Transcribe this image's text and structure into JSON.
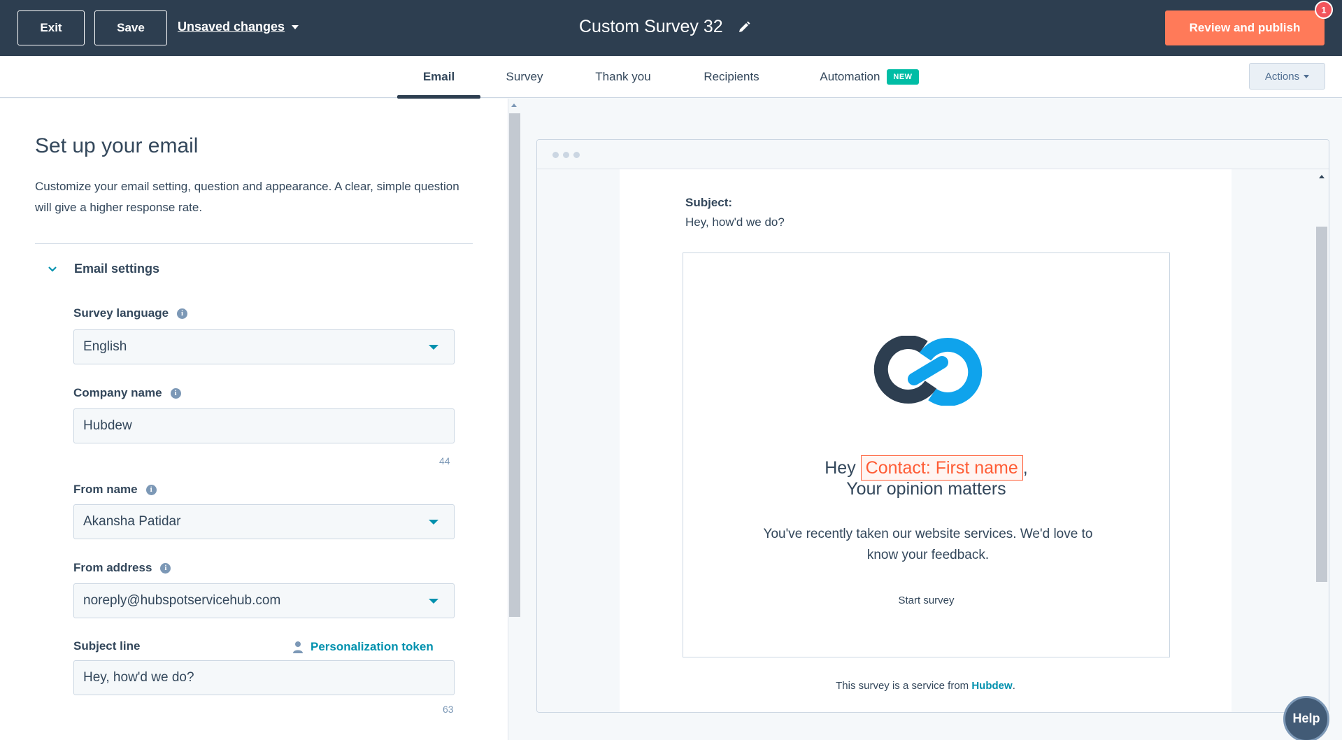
{
  "topbar": {
    "exit_label": "Exit",
    "save_label": "Save",
    "unsaved_label": "Unsaved changes",
    "title": "Custom Survey 32",
    "publish_label": "Review and publish",
    "notification_count": "1"
  },
  "tabs": [
    {
      "label": "Email",
      "active": true
    },
    {
      "label": "Survey"
    },
    {
      "label": "Thank you"
    },
    {
      "label": "Recipients"
    },
    {
      "label": "Automation",
      "badge": "NEW"
    }
  ],
  "actions_label": "Actions",
  "left": {
    "heading": "Set up your email",
    "intro": "Customize your email setting, question and appearance. A clear, simple question will give a higher response rate.",
    "section_title": "Email settings",
    "fields": {
      "survey_language": {
        "label": "Survey language",
        "value": "English"
      },
      "company_name": {
        "label": "Company name",
        "value": "Hubdew",
        "count": "44"
      },
      "from_name": {
        "label": "From name",
        "value": "Akansha Patidar"
      },
      "from_address": {
        "label": "From address",
        "value": "noreply@hubspotservicehub.com"
      },
      "subject_line": {
        "label": "Subject line",
        "value": "Hey, how'd we do?",
        "count": "63",
        "token_label": "Personalization token"
      }
    }
  },
  "preview": {
    "subject_label": "Subject:",
    "subject_value": "Hey, how'd we do?",
    "greeting_prefix": "Hey",
    "token": "Contact: First name",
    "greeting_suffix": ",",
    "greeting_line2": "Your opinion matters",
    "body": "You've recently taken our website services. We'd love to know your feedback.",
    "start_survey": "Start survey",
    "footer_prefix": "This survey is a service from",
    "footer_link": "Hubdew",
    "footer_suffix": "."
  },
  "help_label": "Help",
  "icons": [
    "pencil-icon",
    "caret-down-icon",
    "info-icon",
    "chevron-down-icon",
    "person-icon",
    "logo-icon"
  ],
  "colors": {
    "topbar": "#2d3e50",
    "primary": "#ff7a59",
    "accent": "#0091ae",
    "badge": "#00bda5",
    "token": "#ff5c35"
  }
}
